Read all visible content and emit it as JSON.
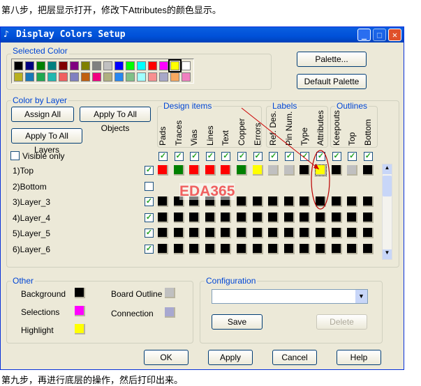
{
  "caption_top": "第八步，把层显示打开，修改下Attributes的颜色显示。",
  "caption_bottom": "第九步，再进行底层的操作，然后打印出来。",
  "window": {
    "title": "Display Colors Setup"
  },
  "selected_color": {
    "label": "Selected Color",
    "palette": [
      [
        "#000000",
        "#000080",
        "#008000",
        "#008080",
        "#800000",
        "#800080",
        "#808000",
        "#808080",
        "#c0c0c0",
        "#0000ff",
        "#00ff00",
        "#00ffff",
        "#ff0000",
        "#ff00ff",
        "#ffff00",
        "#ffffff"
      ],
      [
        "#b8b020",
        "#1878b8",
        "#20a850",
        "#20b8b0",
        "#f06060",
        "#8080c0",
        "#c06010",
        "#f00080",
        "#b0b080",
        "#2888f0",
        "#80c088",
        "#a0ffff",
        "#f89090",
        "#a8a8c8",
        "#f8a860",
        "#f080c0"
      ]
    ],
    "selected": "#ffff00"
  },
  "buttons": {
    "palette": "Palette...",
    "default_palette": "Default Palette",
    "assign_all": "Assign All",
    "apply_all_objects": "Apply To All Objects",
    "apply_all_layers": "Apply To All Layers",
    "save": "Save",
    "delete": "Delete",
    "ok": "OK",
    "apply": "Apply",
    "cancel": "Cancel",
    "help": "Help"
  },
  "color_by_layer": {
    "label": "Color by Layer",
    "visible_only": "Visible only",
    "groups": [
      "Design items",
      "Labels",
      "Outlines"
    ],
    "columns": [
      "Pads",
      "Traces",
      "Vias",
      "Lines",
      "Text",
      "Copper",
      "Errors",
      "Ref. Des.",
      "Pin Num.",
      "Type",
      "Attributes",
      "Keepouts",
      "Top",
      "Bottom"
    ],
    "column_checked": [
      true,
      true,
      true,
      true,
      true,
      true,
      true,
      true,
      true,
      true,
      true,
      true,
      true,
      true
    ],
    "layers": [
      {
        "name": "1)Top",
        "visible": true,
        "colors": [
          "#ff0000",
          "#008000",
          "#ff0000",
          "#ff0000",
          "#ff0000",
          "#008000",
          "#ffff00",
          "#c0c0c0",
          "#c0c0c0",
          "#000000",
          "#ffff00",
          "#000000",
          "#c0c0c0",
          "#000000"
        ]
      },
      {
        "name": "2)Bottom",
        "visible": false,
        "colors": []
      },
      {
        "name": "3)Layer_3",
        "visible": true,
        "colors": [
          "#000000",
          "#000000",
          "#000000",
          "#000000",
          "#000000",
          "#000000",
          "#000000",
          "#000000",
          "#000000",
          "#000000",
          "#000000",
          "#000000",
          "#000000",
          "#000000"
        ]
      },
      {
        "name": "4)Layer_4",
        "visible": true,
        "colors": [
          "#000000",
          "#000000",
          "#000000",
          "#000000",
          "#000000",
          "#000000",
          "#000000",
          "#000000",
          "#000000",
          "#000000",
          "#000000",
          "#000000",
          "#000000",
          "#000000"
        ]
      },
      {
        "name": "5)Layer_5",
        "visible": true,
        "colors": [
          "#000000",
          "#000000",
          "#000000",
          "#000000",
          "#000000",
          "#000000",
          "#000000",
          "#000000",
          "#000000",
          "#000000",
          "#000000",
          "#000000",
          "#000000",
          "#000000"
        ]
      },
      {
        "name": "6)Layer_6",
        "visible": true,
        "colors": [
          "#000000",
          "#000000",
          "#000000",
          "#000000",
          "#000000",
          "#000000",
          "#000000",
          "#000000",
          "#000000",
          "#000000",
          "#000000",
          "#000000",
          "#000000",
          "#000000"
        ]
      }
    ]
  },
  "watermark": "EDA365",
  "other": {
    "label": "Other",
    "background": "Background",
    "background_color": "#000000",
    "selections": "Selections",
    "selections_color": "#ff00ff",
    "highlight": "Highlight",
    "highlight_color": "#ffff00",
    "board_outline": "Board Outline",
    "board_outline_color": "#c0c0c0",
    "connection": "Connection",
    "connection_color": "#a8a8d0"
  },
  "configuration": {
    "label": "Configuration",
    "value": ""
  }
}
